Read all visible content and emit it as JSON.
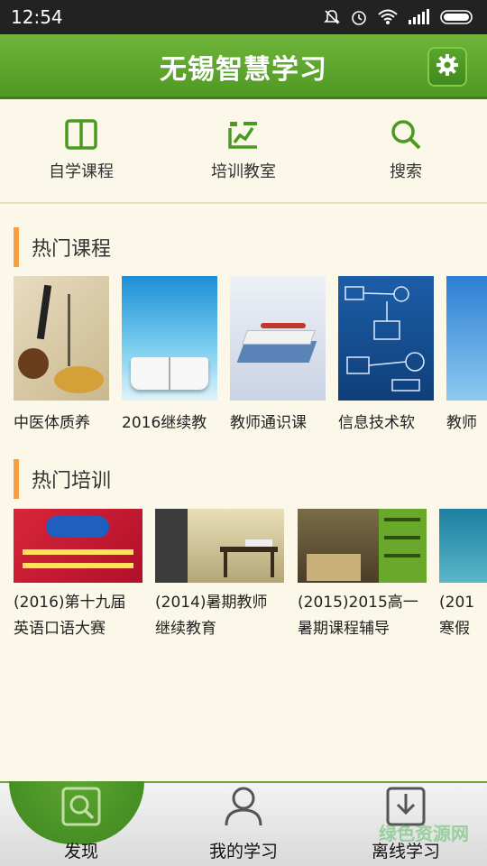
{
  "status_bar": {
    "time": "12:54"
  },
  "header": {
    "title": "无锡智慧学习"
  },
  "top_nav": [
    {
      "label": "自学课程",
      "icon": "book-icon"
    },
    {
      "label": "培训教室",
      "icon": "chart-icon"
    },
    {
      "label": "搜索",
      "icon": "search-icon"
    }
  ],
  "sections": {
    "hot_courses_title": "热门课程",
    "hot_training_title": "热门培训"
  },
  "courses": [
    {
      "title": "中医体质养"
    },
    {
      "title": "2016继续教"
    },
    {
      "title": "教师通识课"
    },
    {
      "title": "信息技术软"
    },
    {
      "title": "教师"
    }
  ],
  "trainings": [
    {
      "line1": "(2016)第十九届",
      "line2": "英语口语大赛"
    },
    {
      "line1": "(2014)暑期教师",
      "line2": "继续教育"
    },
    {
      "line1": "(2015)2015高一",
      "line2": "暑期课程辅导"
    },
    {
      "line1": "(201",
      "line2": "寒假"
    }
  ],
  "bottom_tabs": [
    {
      "label": "发现",
      "active": true
    },
    {
      "label": "我的学习",
      "active": false
    },
    {
      "label": "离线学习",
      "active": false
    }
  ],
  "watermark": "绿色资源网",
  "colors": {
    "header_green": "#5aa52c",
    "accent_orange": "#f6a041",
    "background": "#fbf8e9"
  }
}
